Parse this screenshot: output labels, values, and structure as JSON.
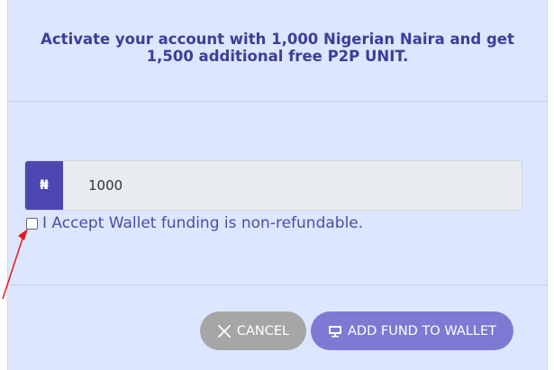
{
  "modal": {
    "title": "Activate your account with 1,000 Nigerian Naira and get 1,500 additional free P2P UNIT."
  },
  "form": {
    "currency_symbol": "₦",
    "amount_value": "1000",
    "accept_label": "I Accept Wallet funding is non-refundable.",
    "accept_checked": false
  },
  "buttons": {
    "cancel_label": "CANCEL",
    "add_fund_label": "ADD FUND TO WALLET"
  },
  "icons": {
    "cancel": "close-icon",
    "add_fund": "monitor-icon"
  },
  "colors": {
    "modal_bg": "#dde6ff",
    "title_text": "#3a3f9a",
    "currency_addon": "#4d48b1",
    "input_bg": "#e8ebef",
    "cancel_button": "#a6a6a6",
    "add_fund_button": "#7d7ad3",
    "annotation_arrow": "#e31b1b"
  }
}
